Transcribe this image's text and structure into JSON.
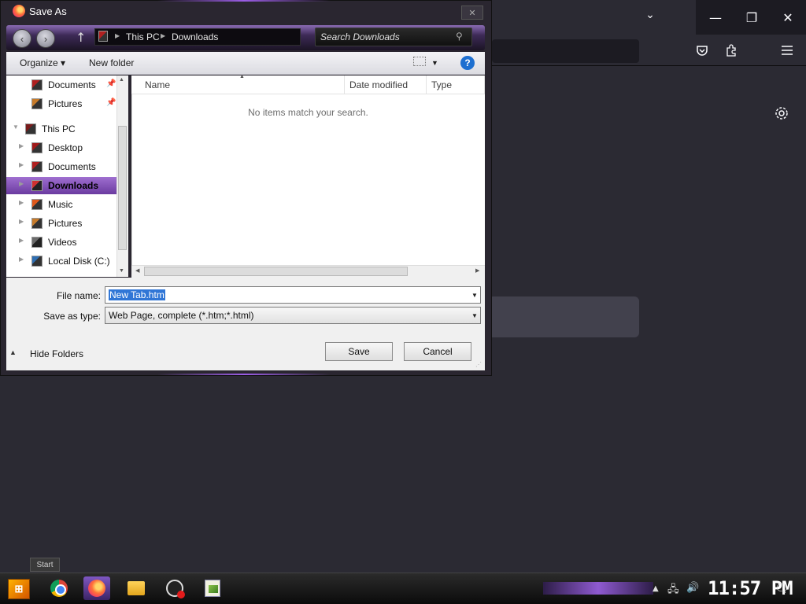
{
  "dialog": {
    "title": "Save As",
    "close_glyph": "✕",
    "breadcrumb": [
      "This PC",
      "Downloads"
    ],
    "search_placeholder": "Search Downloads",
    "toolbar": {
      "organize": "Organize ▾",
      "new_folder": "New folder",
      "help": "?"
    },
    "nav": {
      "items": [
        {
          "label": "Documents",
          "pinned": true
        },
        {
          "label": "Pictures",
          "pinned": true
        },
        {
          "label": "This PC"
        },
        {
          "label": "Desktop"
        },
        {
          "label": "Documents"
        },
        {
          "label": "Downloads",
          "selected": true
        },
        {
          "label": "Music"
        },
        {
          "label": "Pictures"
        },
        {
          "label": "Videos"
        },
        {
          "label": "Local Disk (C:)"
        }
      ]
    },
    "columns": [
      "Name",
      "Date modified",
      "Type"
    ],
    "empty_message": "No items match your search.",
    "file_name_label": "File name:",
    "file_name_value": "New Tab.htm",
    "save_type_label": "Save as type:",
    "save_type_value": "Web Page, complete (*.htm;*.html)",
    "save_button": "Save",
    "cancel_button": "Cancel",
    "hide_folders": "Hide Folders"
  },
  "taskbar": {
    "start_tooltip": "Start",
    "clock": "11:57 PM",
    "apps": [
      "chrome-icon",
      "firefox-icon",
      "file-explorer-icon",
      "obs-icon",
      "notepad-plus-icon"
    ]
  },
  "colors": {
    "accent": "#8f5ad1",
    "selection": "#3076d6",
    "firefox_bg": "#2b2a33"
  }
}
